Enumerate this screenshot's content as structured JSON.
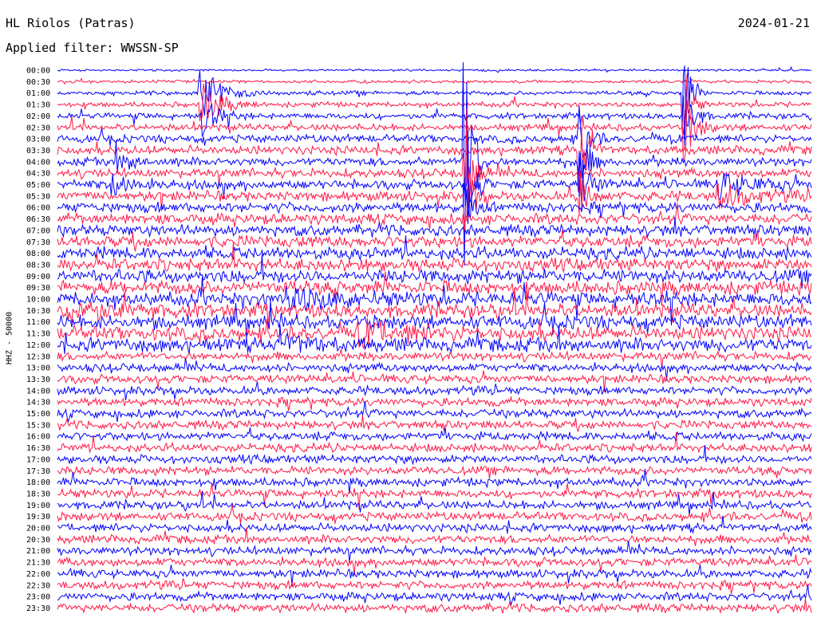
{
  "header": {
    "station": "HL Riolos (Patras)",
    "date": "2024-01-21",
    "filter": "Applied filter: WWSSN-SP"
  },
  "chart_data": {
    "type": "line",
    "title": "HL Riolos (Patras)",
    "ylabel": "HHZ - 50000",
    "row_labels": [
      "00:00",
      "00:30",
      "01:00",
      "01:30",
      "02:00",
      "02:30",
      "03:00",
      "03:30",
      "04:00",
      "04:30",
      "05:00",
      "05:30",
      "06:00",
      "06:30",
      "07:00",
      "07:30",
      "08:00",
      "08:30",
      "09:00",
      "09:30",
      "10:00",
      "10:30",
      "11:00",
      "11:30",
      "12:00",
      "12:30",
      "13:00",
      "13:30",
      "14:00",
      "14:30",
      "15:00",
      "15:30",
      "16:00",
      "16:30",
      "17:00",
      "17:30",
      "18:00",
      "18:30",
      "19:00",
      "19:30",
      "20:00",
      "20:30",
      "21:00",
      "21:30",
      "22:00",
      "22:30",
      "23:00",
      "23:30"
    ],
    "colors": [
      "#0000ff",
      "#ff1744"
    ],
    "grid": false
  }
}
